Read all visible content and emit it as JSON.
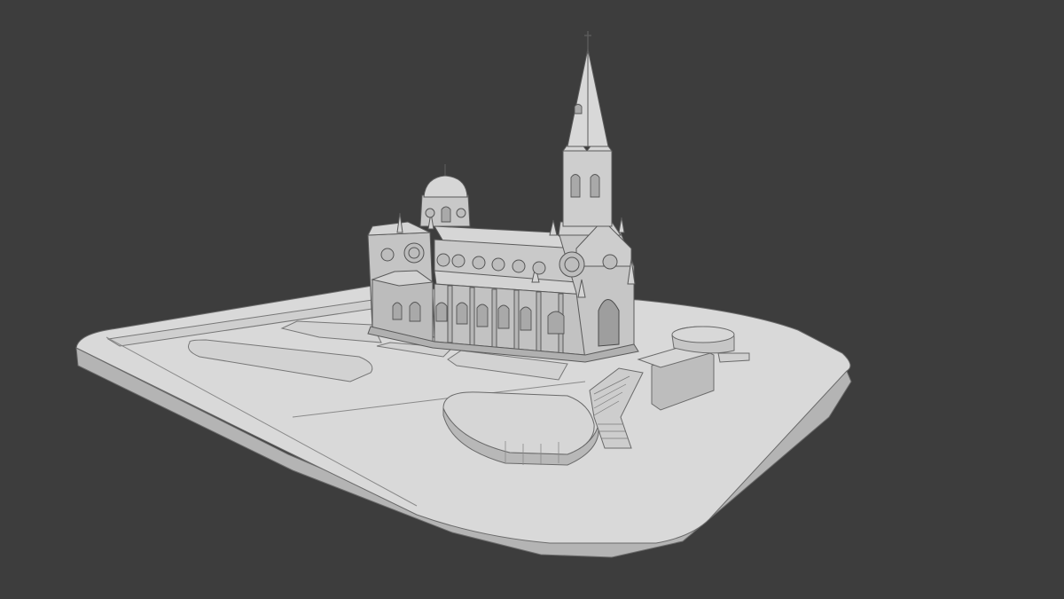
{
  "viewport": {
    "background": "#3d3d3d"
  },
  "model": {
    "subject": "gothic-church-with-spire-on-terrain-plot",
    "shading": "clay-grey",
    "colors": {
      "top": "#d8d8d8",
      "side": "#b9b9b9",
      "shadow": "#a6a6a6",
      "line": "#6a6a6a",
      "dark_line": "#4a4a4a"
    }
  }
}
